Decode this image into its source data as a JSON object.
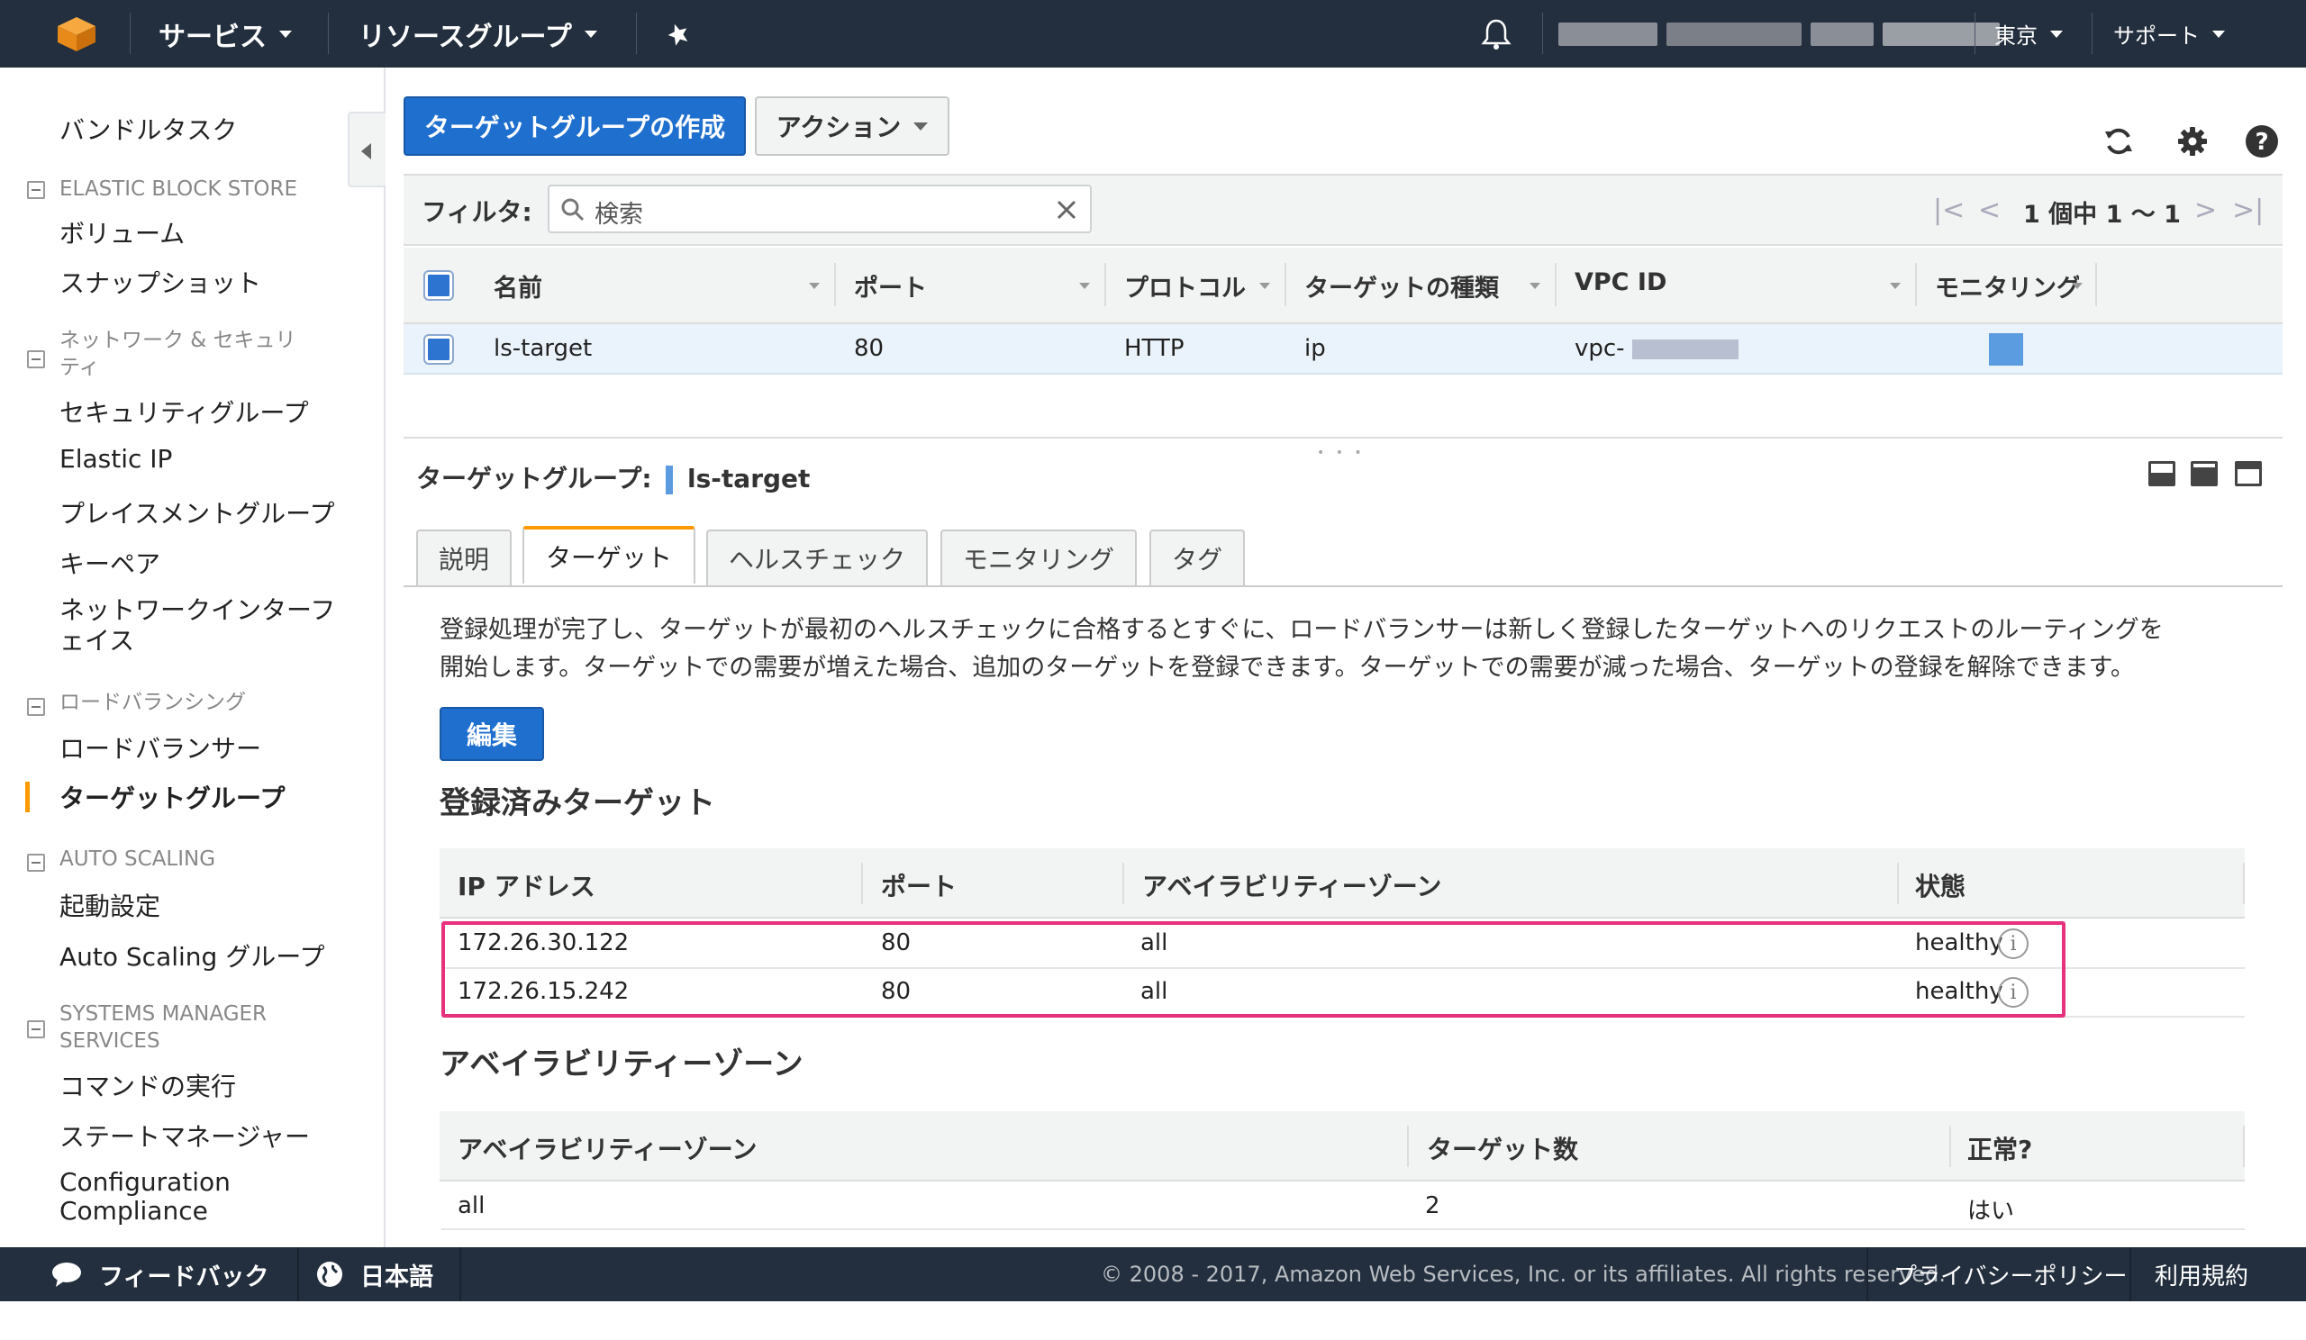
{
  "topnav": {
    "logo_icon": "aws-cube-icon",
    "services": "サービス",
    "resource_groups": "リソースグループ",
    "pin_icon": "pin-icon",
    "bell_icon": "bell-icon",
    "region": "東京",
    "support": "サポート"
  },
  "sidebar": {
    "bundle_tasks": "バンドルタスク",
    "ebs_header": "ELASTIC BLOCK STORE",
    "volumes": "ボリューム",
    "snapshots": "スナップショット",
    "network_header_1": "ネットワーク & セキュリ",
    "network_header_2": "ティ",
    "security_groups": "セキュリティグループ",
    "elastic_ip": "Elastic IP",
    "placement_groups": "プレイスメントグループ",
    "key_pairs": "キーペア",
    "network_interfaces_1": "ネットワークインターフ",
    "network_interfaces_2": "ェイス",
    "lb_header": "ロードバランシング",
    "load_balancers": "ロードバランサー",
    "target_groups": "ターゲットグループ",
    "as_header": "AUTO SCALING",
    "launch_config": "起動設定",
    "as_groups": "Auto Scaling グループ",
    "ssm_header_1": "SYSTEMS MANAGER",
    "ssm_header_2": "SERVICES",
    "run_command": "コマンドの実行",
    "state_manager": "ステートマネージャー",
    "config_1": "Configuration",
    "config_2": "Compliance"
  },
  "toolbar": {
    "create_button": "ターゲットグループの作成",
    "actions_button": "アクション",
    "refresh_icon": "refresh-icon",
    "settings_icon": "gear-icon",
    "help_icon": "help-icon"
  },
  "filter": {
    "label": "フィルタ:",
    "placeholder": "検索",
    "pager_text": "1 個中 1 ～ 1"
  },
  "table": {
    "headers": [
      "名前",
      "ポート",
      "プロトコル",
      "ターゲットの種類",
      "VPC ID",
      "モニタリング"
    ],
    "row": {
      "name": "ls-target",
      "port": "80",
      "protocol": "HTTP",
      "target_type": "ip",
      "vpc_prefix": "vpc-"
    }
  },
  "detail": {
    "label": "ターゲットグループ:",
    "name": "ls-target",
    "tabs": [
      "説明",
      "ターゲット",
      "ヘルスチェック",
      "モニタリング",
      "タグ"
    ],
    "active_tab": 1,
    "description_line1": "登録処理が完了し、ターゲットが最初のヘルスチェックに合格するとすぐに、ロードバランサーは新しく登録したターゲットへのリクエストのルーティングを",
    "description_line2": "開始します。ターゲットでの需要が増えた場合、追加のターゲットを登録できます。ターゲットでの需要が減った場合、ターゲットの登録を解除できます。",
    "edit_button": "編集",
    "registered_title": "登録済みターゲット",
    "registered_headers": [
      "IP アドレス",
      "ポート",
      "アベイラビリティーゾーン",
      "状態"
    ],
    "registered_rows": [
      {
        "ip": "172.26.30.122",
        "port": "80",
        "az": "all",
        "status": "healthy"
      },
      {
        "ip": "172.26.15.242",
        "port": "80",
        "az": "all",
        "status": "healthy"
      }
    ],
    "az_title": "アベイラビリティーゾーン",
    "az_headers": [
      "アベイラビリティーゾーン",
      "ターゲット数",
      "正常?"
    ],
    "az_rows": [
      {
        "az": "all",
        "count": "2",
        "healthy": "はい"
      }
    ]
  },
  "footer": {
    "feedback": "フィードバック",
    "language": "日本語",
    "copyright": "© 2008 - 2017, Amazon Web Services, Inc. or its affiliates. All rights reserved.",
    "privacy": "プライバシーポリシー",
    "terms": "利用規約"
  },
  "colors": {
    "nav_bg": "#232f3e",
    "primary": "#1f6fcf",
    "accent": "#ff9900",
    "highlight": "#e8317d"
  }
}
